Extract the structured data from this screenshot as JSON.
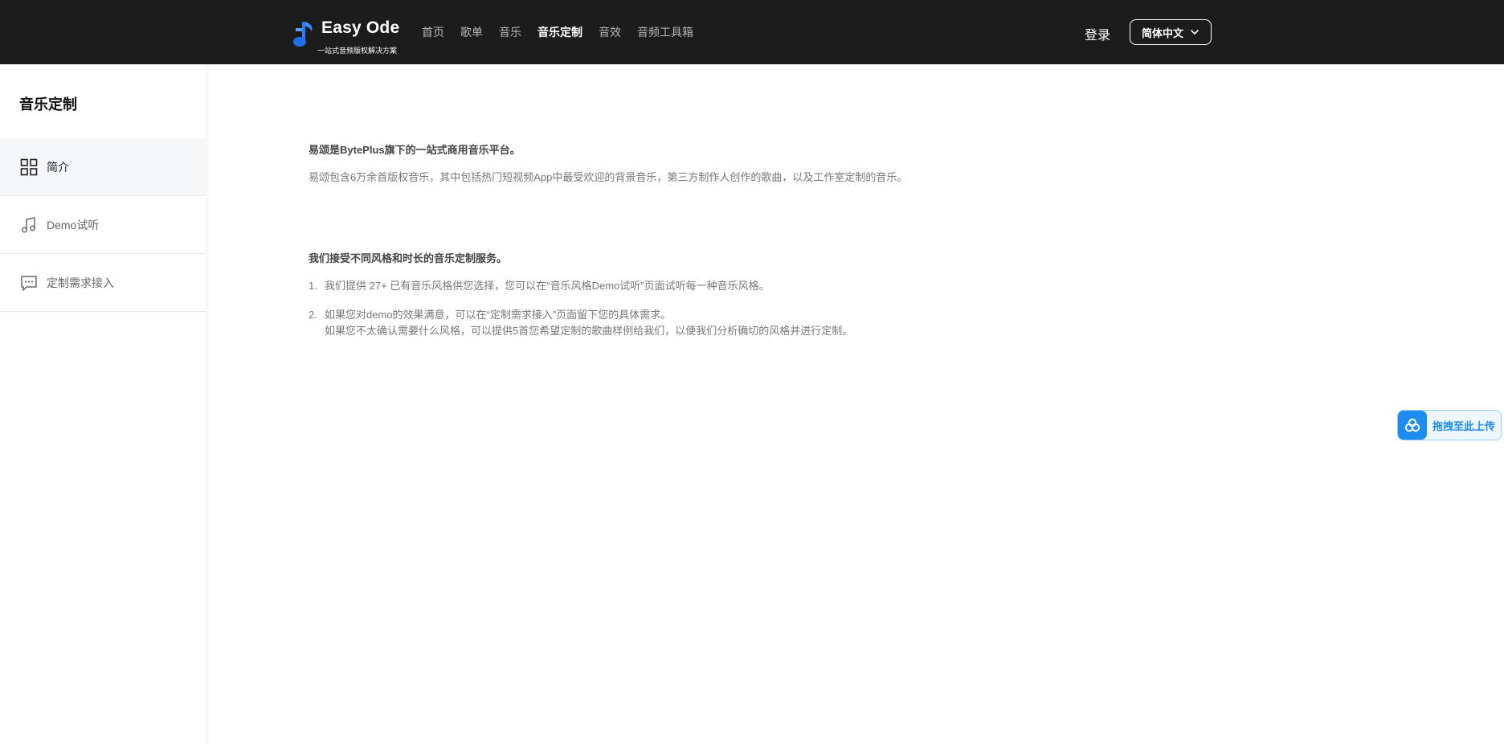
{
  "header": {
    "logo_title": "Easy Ode",
    "logo_subtitle": "一站式音频版权解决方案",
    "nav": [
      {
        "label": "首页"
      },
      {
        "label": "歌单"
      },
      {
        "label": "音乐"
      },
      {
        "label": "音乐定制",
        "active": true
      },
      {
        "label": "音效"
      },
      {
        "label": "音频工具箱"
      }
    ],
    "login_label": "登录",
    "language_label": "简体中文"
  },
  "sidebar": {
    "title": "音乐定制",
    "items": [
      {
        "label": "简介",
        "icon": "grid-icon",
        "active": true
      },
      {
        "label": "Demo试听",
        "icon": "music-note-icon"
      },
      {
        "label": "定制需求接入",
        "icon": "chat-bubble-icon"
      }
    ]
  },
  "main": {
    "intro_heading": "易颂是BytePlus旗下的一站式商用音乐平台。",
    "intro_text": "易颂包含6万余首版权音乐，其中包括热门短视频App中最受欢迎的背景音乐，第三方制作人创作的歌曲，以及工作室定制的音乐。",
    "service_heading": "我们接受不同风格和时长的音乐定制服务。",
    "steps": [
      {
        "num": "1.",
        "lines": [
          "我们提供 27+ 已有音乐风格供您选择，您可以在“音乐风格Demo试听”页面试听每一种音乐风格。"
        ]
      },
      {
        "num": "2.",
        "lines": [
          "如果您对demo的效果满意，可以在“定制需求接入”页面留下您的具体需求。",
          "如果您不太确认需要什么风格，可以提供5首您希望定制的歌曲样例给我们，以便我们分析确切的风格并进行定制。"
        ]
      }
    ]
  },
  "upload_widget": {
    "label": "拖拽至此上传",
    "icon": "cloud-upload-icon"
  },
  "colors": {
    "header_bg": "#1c1c1c",
    "accent_blue": "#1e8bf0",
    "sidebar_active_bg": "#f5f6f8"
  }
}
